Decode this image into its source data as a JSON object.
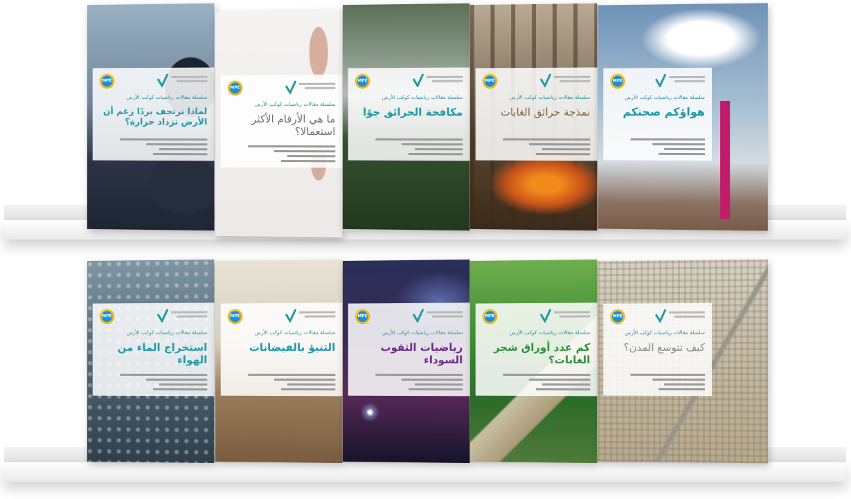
{
  "brand": {
    "logo_mpe": "MPE",
    "series_label": "سلسلة مقالات رياضيات كوكب الأرض",
    "accent_teal": "#1f9aa8",
    "accent_green": "#2f8f3a",
    "accent_purple": "#6b2a8a"
  },
  "shelves": [
    {
      "books": [
        {
          "title": "هواؤكم صحتكم",
          "title_color": "#1f9aa8"
        },
        {
          "title": "نمذجة حرائق الغابات",
          "title_color": "#7a6a4c"
        },
        {
          "title": "مكافحة الحرائق جوًا",
          "title_color": "#1f9aa8"
        },
        {
          "title": "ما هي الأرقام الأكثر استعمالا؟",
          "title_color": "#6f6f6f"
        },
        {
          "title": "لماذا نرتجف بردًا رغم أن الأرض تزداد حرارة؟",
          "title_color": "#1f9aa8"
        }
      ]
    },
    {
      "books": [
        {
          "title": "كيف تتوسع المدن؟",
          "title_color": "#8a8a8a"
        },
        {
          "title": "كم عدد أوراق شجر الغابات؟",
          "title_color": "#2f8f3a"
        },
        {
          "title": "رياضيات الثقوب السوداء",
          "title_color": "#6b2a8a"
        },
        {
          "title": "التنبؤ بالفيضانات",
          "title_color": "#1f9aa8"
        },
        {
          "title": "استخراج الماء من الهواء",
          "title_color": "#1f9aa8"
        }
      ]
    }
  ]
}
